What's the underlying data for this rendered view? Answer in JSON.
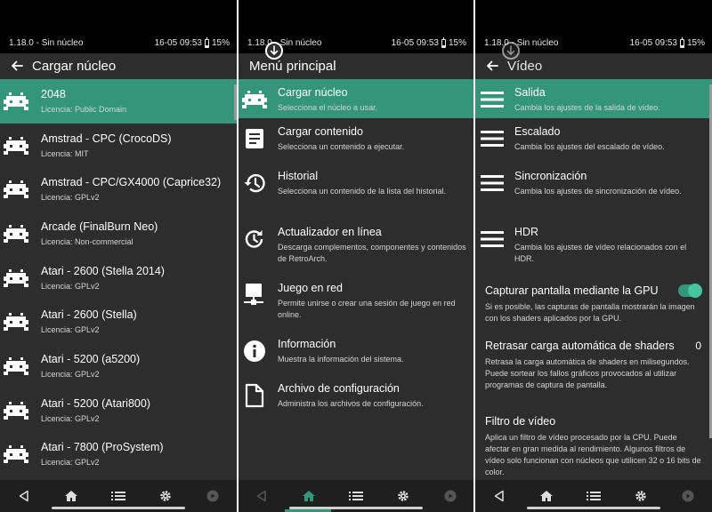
{
  "status": {
    "left": "1.18.0 - Sin núcleo",
    "datetime": "16-05 09:53",
    "battery": "15%"
  },
  "screen1": {
    "title": "Cargar núcleo",
    "cores": [
      {
        "name": "2048",
        "license": "Licencia: Public Domain"
      },
      {
        "name": "Amstrad - CPC (CrocoDS)",
        "license": "Licencia: MIT"
      },
      {
        "name": "Amstrad - CPC/GX4000 (Caprice32)",
        "license": "Licencia: GPLv2"
      },
      {
        "name": "Arcade (FinalBurn Neo)",
        "license": "Licencia: Non-commercial"
      },
      {
        "name": "Atari - 2600 (Stella 2014)",
        "license": "Licencia: GPLv2"
      },
      {
        "name": "Atari - 2600 (Stella)",
        "license": "Licencia: GPLv2"
      },
      {
        "name": "Atari - 5200 (a5200)",
        "license": "Licencia: GPLv2"
      },
      {
        "name": "Atari - 5200 (Atari800)",
        "license": "Licencia: GPLv2"
      },
      {
        "name": "Atari - 7800 (ProSystem)",
        "license": "Licencia: GPLv2"
      }
    ]
  },
  "screen2": {
    "title": "Menú principal",
    "items": [
      {
        "title": "Cargar núcleo",
        "desc": "Selecciona el núcleo a usar.",
        "icon": "invader-icon"
      },
      {
        "title": "Cargar contenido",
        "desc": "Selecciona un contenido a ejecutar.",
        "icon": "document-lines-icon"
      },
      {
        "title": "Historial",
        "desc": "Selecciona un contenido de la lista del historial.",
        "icon": "history-icon"
      },
      {
        "title": "Actualizador en línea",
        "desc": "Descarga complementos, componentes y contenidos de RetroArch.",
        "icon": "update-icon"
      },
      {
        "title": "Juego en red",
        "desc": "Permite unirse o crear una sesión de juego en red online.",
        "icon": "network-icon"
      },
      {
        "title": "Información",
        "desc": "Muestra la información del sistema.",
        "icon": "info-icon"
      },
      {
        "title": "Archivo de configuración",
        "desc": "Administra los archivos de configuración.",
        "icon": "file-icon"
      }
    ]
  },
  "screen3": {
    "title": "Vídeo",
    "submenus": [
      {
        "title": "Salida",
        "desc": "Cambia los ajustes de la salida de vídeo."
      },
      {
        "title": "Escalado",
        "desc": "Cambia los ajustes del escalado de vídeo."
      },
      {
        "title": "Sincronización",
        "desc": "Cambia los ajustes de sincronización de vídeo."
      },
      {
        "title": "HDR",
        "desc": "Cambia los ajustes de vídeo relacionados con el HDR."
      }
    ],
    "settings": [
      {
        "title": "Capturar pantalla mediante la GPU",
        "desc": "Si es posible, las capturas de pantalla mostrarán la imagen con los shaders aplicados por la GPU.",
        "value": "",
        "toggle": true
      },
      {
        "title": "Retrasar carga automática de shaders",
        "desc": "Retrasa la carga automática de shaders en milisegundos. Puede sortear los fallos gráficos provocados al utilizar programas de captura de pantalla.",
        "value": "0",
        "toggle": false
      },
      {
        "title": "Filtro de vídeo",
        "desc": "Aplica un filtro de vídeo procesado por la CPU. Puede afectar en gran medida al rendimiento. Algunos filtros de vídeo solo funcionan con núcleos que utilicen 32 o 16 bits de color.",
        "value": "",
        "toggle": false
      }
    ]
  },
  "colors": {
    "accent": "#33957a",
    "background": "#2d2d2d",
    "navbar": "#1f1f1f"
  }
}
